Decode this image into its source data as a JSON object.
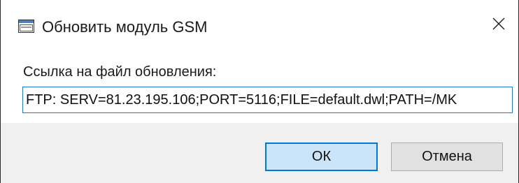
{
  "window": {
    "title": "Обновить модуль GSM",
    "app_icon": "window-app-icon",
    "close_icon": "close-icon"
  },
  "form": {
    "label": "Ссылка на файл обновления:",
    "url_value": "FTP: SERV=81.23.195.106;PORT=5116;FILE=default.dwl;PATH=/MK"
  },
  "buttons": {
    "ok_label": "ОК",
    "cancel_label": "Отмена"
  },
  "colors": {
    "focus_border": "#0078d7",
    "ok_background": "#cce4f7",
    "footer_background": "#f0f0f0"
  }
}
